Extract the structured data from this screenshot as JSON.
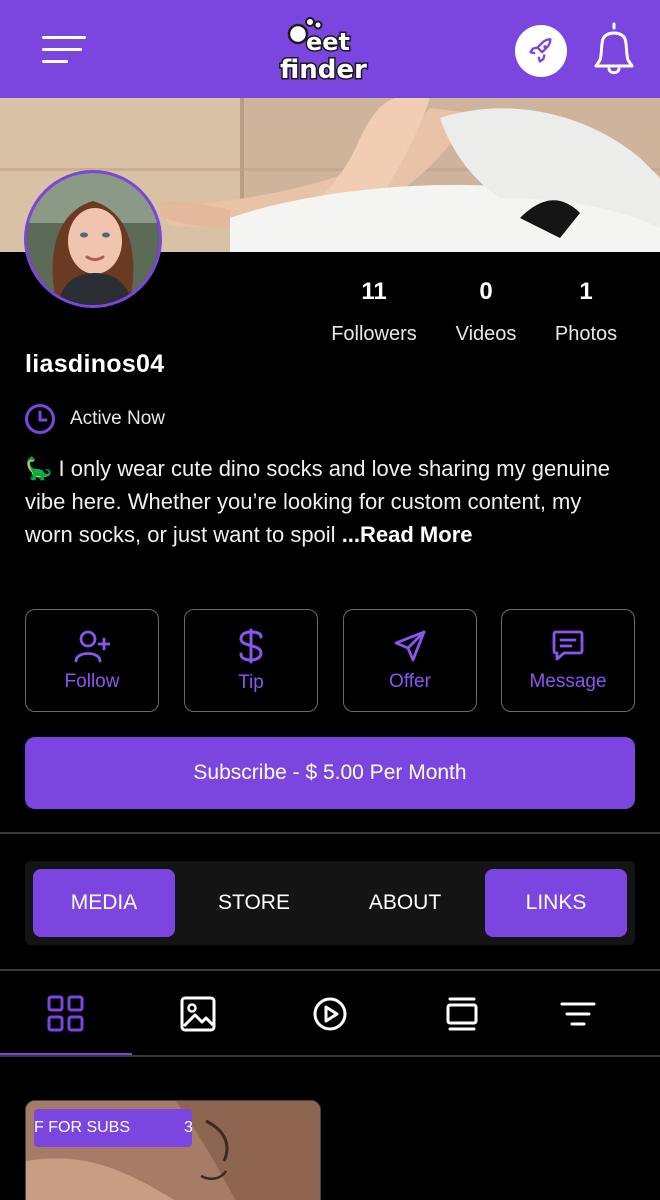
{
  "header": {
    "logo_text_1": "feet",
    "logo_text_2": "finder",
    "menu_icon": "hamburger-icon",
    "boost_icon": "rocket-icon",
    "notifications_icon": "bell-icon"
  },
  "profile": {
    "username": "liasdinos04",
    "status": "Active Now",
    "bio_text": "🦕 I only wear cute dino socks and love sharing my genuine vibe here. Whether you’re looking for custom content, my worn socks, or just want to spoil ",
    "read_more": "...Read More"
  },
  "stats": [
    {
      "value": "11",
      "label": "Followers"
    },
    {
      "value": "0",
      "label": "Videos"
    },
    {
      "value": "1",
      "label": "Photos"
    }
  ],
  "actions": {
    "follow": "Follow",
    "tip": "Tip",
    "offer": "Offer",
    "message": "Message"
  },
  "subscribe_label": "Subscribe - $ 5.00 Per Month",
  "tabs": [
    {
      "label": "MEDIA",
      "active": true
    },
    {
      "label": "STORE",
      "active": false
    },
    {
      "label": "ABOUT",
      "active": false
    },
    {
      "label": "LINKS",
      "active": true
    }
  ],
  "filters": [
    "grid-icon",
    "image-icon",
    "play-icon",
    "collection-icon",
    "sort-icon"
  ],
  "media_card": {
    "badge": "F FOR SUBS",
    "count": "3"
  },
  "colors": {
    "accent": "#7b45e0",
    "background": "#000000",
    "border": "#6a6a6a"
  }
}
